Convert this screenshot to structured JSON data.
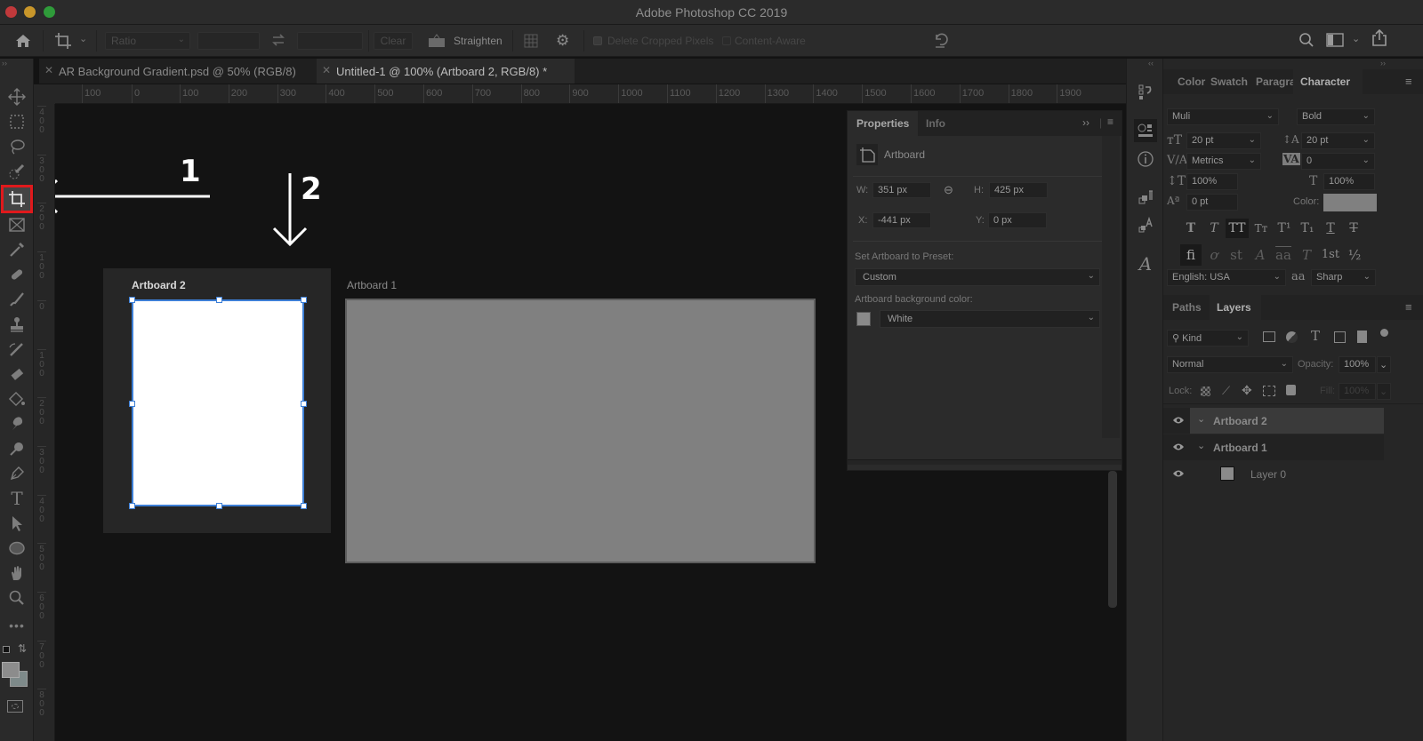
{
  "window": {
    "title": "Adobe Photoshop CC 2019",
    "traffic_lights": {
      "close": "#c0393b",
      "minimize": "#c8962a",
      "maximize": "#2f9b3a"
    }
  },
  "options_bar": {
    "home_icon": "home-icon",
    "tool_preset_icon": "crop-icon",
    "ratio_label": "Ratio",
    "width_value": "",
    "height_value": "",
    "swap_icon": "swap-icon",
    "clear_label": "Clear",
    "straighten_label": "Straighten",
    "overlay_icon": "grid-icon",
    "settings_icon": "gear-icon",
    "delete_cropped_label": "Delete Cropped Pixels",
    "delete_cropped_checked": true,
    "content_aware_label": "Content-Aware",
    "content_aware_checked": false,
    "reset_icon": "reset-icon",
    "search_icon": "search-icon",
    "workspace_icon": "workspace-icon",
    "share_icon": "share-icon"
  },
  "document_tabs": [
    {
      "label": "AR Background Gradient.psd @ 50% (RGB/8)",
      "active": false
    },
    {
      "label": "Untitled-1 @ 100% (Artboard 2, RGB/8) *",
      "active": true
    }
  ],
  "ruler_h": [
    "100",
    "0",
    "100",
    "200",
    "300",
    "400",
    "500",
    "600",
    "700",
    "800",
    "900",
    "1000",
    "1100",
    "1200",
    "1300",
    "1400",
    "1500",
    "1600",
    "1700",
    "1800",
    "1900"
  ],
  "ruler_v": [
    "400",
    "300",
    "200",
    "100",
    "0",
    "100",
    "200",
    "300",
    "400",
    "500",
    "600",
    "700",
    "800"
  ],
  "tools": [
    "move-tool",
    "marquee-tool",
    "lasso-tool",
    "quick-selection-tool",
    "crop-tool",
    "frame-tool",
    "eyedropper-tool",
    "healing-brush-tool",
    "brush-tool",
    "clone-stamp-tool",
    "history-brush-tool",
    "eraser-tool",
    "paint-bucket-tool",
    "blur-tool",
    "dodge-tool",
    "pen-tool",
    "type-tool",
    "path-selection-tool",
    "ellipse-tool",
    "hand-tool",
    "zoom-tool",
    "more-tools"
  ],
  "active_tool": "crop-tool",
  "colors": {
    "foreground": "#8c8c8c",
    "background": "#7e8a8a",
    "highlight": "#e0191c",
    "selection": "#3d7fd6"
  },
  "canvas": {
    "artboards": [
      {
        "name": "Artboard 2",
        "selected": true,
        "fill": "#ffffff"
      },
      {
        "name": "Artboard 1",
        "selected": false,
        "fill": "#808080"
      }
    ],
    "annotations": [
      {
        "number": "1",
        "direction": "left"
      },
      {
        "number": "2",
        "direction": "down"
      }
    ]
  },
  "properties_panel": {
    "tabs": [
      {
        "label": "Properties",
        "active": true
      },
      {
        "label": "Info",
        "active": false
      }
    ],
    "type_label": "Artboard",
    "w_label": "W:",
    "w_value": "351 px",
    "h_label": "H:",
    "h_value": "425 px",
    "x_label": "X:",
    "x_value": "-441 px",
    "y_label": "Y:",
    "y_value": "0 px",
    "preset_label": "Set Artboard to Preset:",
    "preset_value": "Custom",
    "bg_color_label": "Artboard background color:",
    "bg_color_value": "White"
  },
  "character_panel": {
    "tabs": [
      {
        "label": "Color",
        "active": false
      },
      {
        "label": "Swatch",
        "active": false
      },
      {
        "label": "Paragra",
        "active": false
      },
      {
        "label": "Character",
        "active": true
      }
    ],
    "font_family": "Muli",
    "font_style": "Bold",
    "font_size": "20 pt",
    "leading": "20 pt",
    "kerning": "Metrics",
    "tracking": "0",
    "vertical_scale": "100%",
    "horizontal_scale": "100%",
    "baseline_shift": "0 pt",
    "color_label": "Color:",
    "style_buttons": [
      "T",
      "T",
      "TT",
      "Tт",
      "T¹",
      "T₁",
      "T",
      "T"
    ],
    "opentype_buttons": [
      "ﬁ",
      "ơ",
      "st",
      "A",
      "aa",
      "T",
      "1st",
      "½"
    ],
    "language": "English: USA",
    "aa_label": "aa",
    "antialias": "Sharp"
  },
  "layers_panel": {
    "tabs": [
      {
        "label": "Paths",
        "active": false
      },
      {
        "label": "Layers",
        "active": true
      }
    ],
    "filter_label": "Kind",
    "blend_mode": "Normal",
    "opacity_label": "Opacity:",
    "opacity_value": "100%",
    "lock_label": "Lock:",
    "fill_label": "Fill:",
    "fill_value": "100%",
    "layers": [
      {
        "name": "Artboard 2",
        "type": "artboard",
        "visible": true,
        "selected": true
      },
      {
        "name": "Artboard 1",
        "type": "artboard",
        "visible": true,
        "selected": false
      },
      {
        "name": "Layer 0",
        "type": "layer",
        "visible": true,
        "selected": false
      }
    ]
  }
}
